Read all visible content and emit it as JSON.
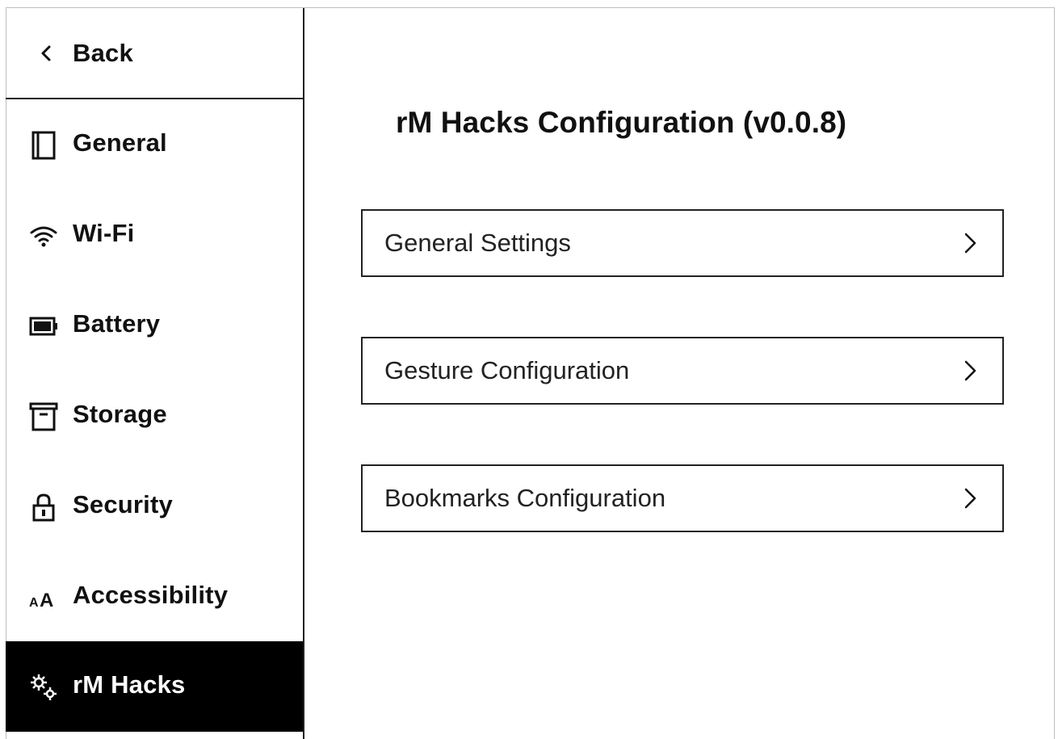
{
  "sidebar": {
    "back_label": "Back",
    "items": [
      {
        "label": "General",
        "icon": "tablet-icon",
        "active": false
      },
      {
        "label": "Wi-Fi",
        "icon": "wifi-icon",
        "active": false
      },
      {
        "label": "Battery",
        "icon": "battery-icon",
        "active": false
      },
      {
        "label": "Storage",
        "icon": "storage-box-icon",
        "active": false
      },
      {
        "label": "Security",
        "icon": "lock-icon",
        "active": false
      },
      {
        "label": "Accessibility",
        "icon": "text-size-icon",
        "active": false
      },
      {
        "label": "rM Hacks",
        "icon": "gears-icon",
        "active": true
      }
    ]
  },
  "main": {
    "title": "rM Hacks Configuration (v0.0.8)",
    "rows": [
      {
        "label": "General Settings"
      },
      {
        "label": "Gesture Configuration"
      },
      {
        "label": "Bookmarks Configuration"
      }
    ]
  },
  "colors": {
    "background": "#ffffff",
    "foreground": "#111111",
    "active_bg": "#000000",
    "active_fg": "#ffffff"
  }
}
